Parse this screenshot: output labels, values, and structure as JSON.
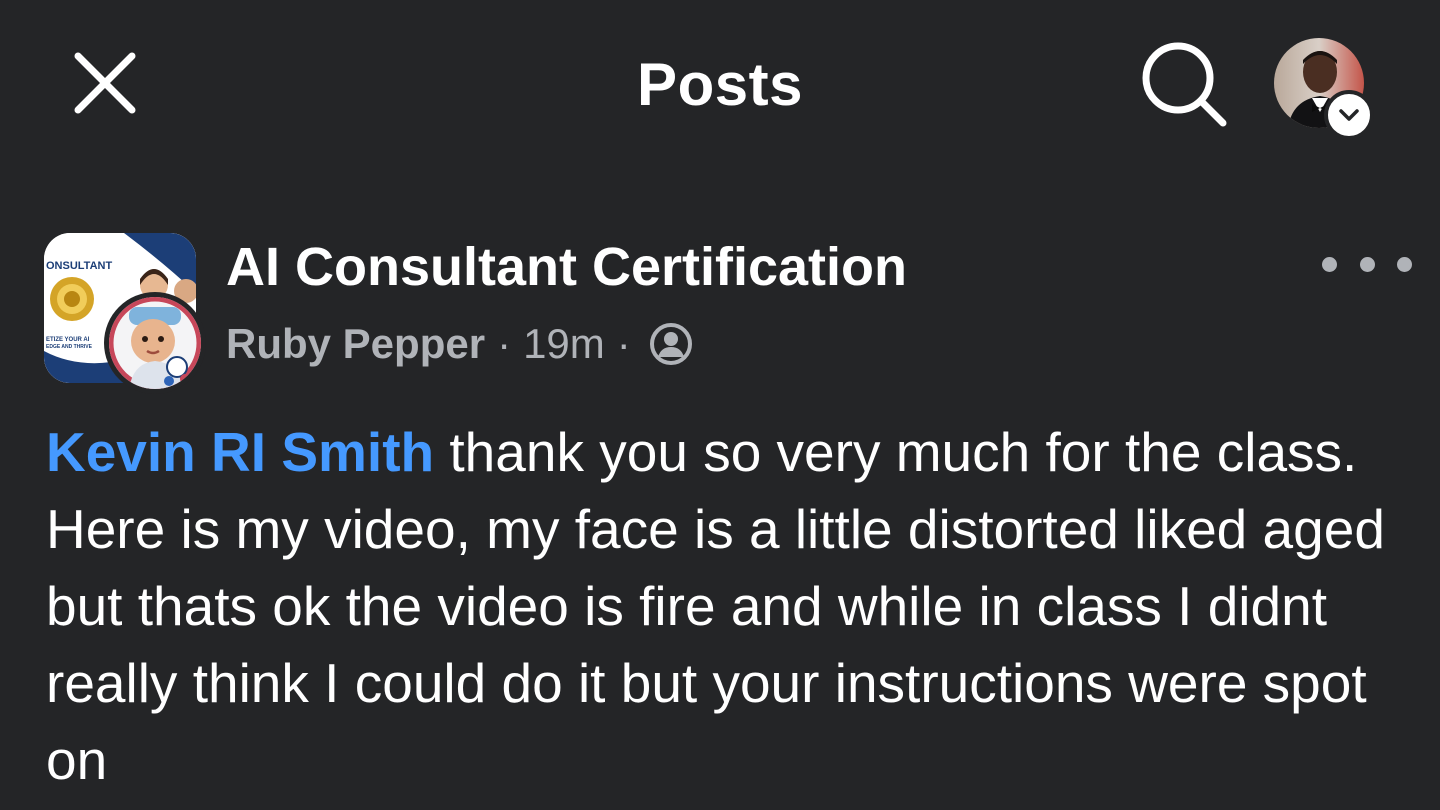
{
  "header": {
    "title": "Posts",
    "close_icon": "close-icon",
    "search_icon": "search-icon",
    "profile_chevron_icon": "chevron-down-icon"
  },
  "post": {
    "group_name": "AI Consultant Certification",
    "thumbnail_text": {
      "line1": "ONSULTANT",
      "line2": "ETIZE YOUR AI",
      "line3": "EDGE AND THRIVE"
    },
    "author": "Ruby Pepper",
    "separator": "·",
    "time": "19m",
    "privacy_icon": "private-group-icon",
    "more_icon": "more-options-icon",
    "mention": "Kevin RI Smith",
    "body": " thank you so very much for the class. Here is my video, my face is a little distorted liked aged but thats ok the video is fire and while in class I didnt really think I could do it but your instructions were spot on"
  },
  "colors": {
    "background": "#242527",
    "text": "#ffffff",
    "secondary_text": "#b0b3b8",
    "mention": "#4599ff"
  }
}
